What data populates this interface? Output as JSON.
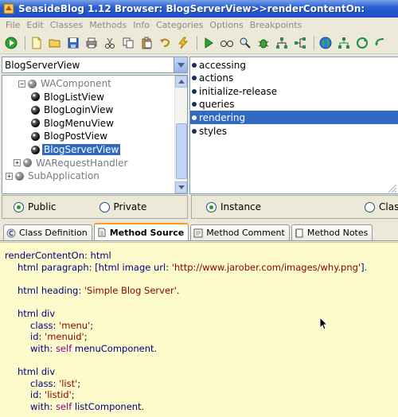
{
  "window": {
    "title": "SeasideBlog 1.12 Browser: BlogServerView>>renderContentOn:"
  },
  "menu": {
    "items": [
      "File",
      "Edit",
      "Classes",
      "Methods",
      "Info",
      "Categories",
      "Options",
      "Breakpoints"
    ]
  },
  "toolbar": {
    "icons": [
      "run-icon",
      "new-page-icon",
      "open-folder-icon",
      "save-icon",
      "print-icon",
      "cut-icon",
      "copy-icon",
      "paste-icon",
      "undo-icon",
      "lightning-icon",
      "play-icon",
      "glasses-icon",
      "magnifier-icon",
      "bug-icon",
      "hierarchy-icon",
      "hierarchy2-icon",
      "globe-icon",
      "tree-icon",
      "refresh-icon",
      "back-icon"
    ]
  },
  "class_pane": {
    "selected_class": "BlogServerView",
    "tree": [
      {
        "label": "WAComponent",
        "indent": 1,
        "expander": "−",
        "grey": true,
        "selected": false
      },
      {
        "label": "BlogListView",
        "indent": 2,
        "expander": "",
        "grey": false,
        "selected": false
      },
      {
        "label": "BlogLoginView",
        "indent": 2,
        "expander": "",
        "grey": false,
        "selected": false
      },
      {
        "label": "BlogMenuView",
        "indent": 2,
        "expander": "",
        "grey": false,
        "selected": false
      },
      {
        "label": "BlogPostView",
        "indent": 2,
        "expander": "",
        "grey": false,
        "selected": false
      },
      {
        "label": "BlogServerView",
        "indent": 2,
        "expander": "",
        "grey": false,
        "selected": true
      },
      {
        "label": "WARequestHandler",
        "indent": 0,
        "expander": "+",
        "grey": true,
        "selected": false
      },
      {
        "label": "SubApplication",
        "indent": -1,
        "expander": "+",
        "grey": true,
        "selected": false
      }
    ]
  },
  "protocol_pane": {
    "items": [
      "accessing",
      "actions",
      "initialize-release",
      "queries",
      "rendering",
      "styles"
    ],
    "selected": "rendering"
  },
  "visibility_radio": {
    "options": [
      {
        "label": "Public",
        "checked": true
      },
      {
        "label": "Private",
        "checked": false
      }
    ]
  },
  "side_radio": {
    "options": [
      {
        "label": "Instance",
        "checked": true
      },
      {
        "label": "Clas",
        "checked": false
      }
    ]
  },
  "tabs": [
    {
      "label": "Class Definition",
      "icon": "class-icon",
      "active": false
    },
    {
      "label": "Method Source",
      "icon": "document-icon",
      "active": true
    },
    {
      "label": "Method Comment",
      "icon": "comment-icon",
      "active": false
    },
    {
      "label": "Method Notes",
      "icon": "notes-icon",
      "active": false
    }
  ],
  "source": {
    "lines": [
      {
        "indent": 0,
        "parts": [
          {
            "t": "renderContentOn: html",
            "c": "kw"
          }
        ]
      },
      {
        "indent": 1,
        "parts": [
          {
            "t": "html paragraph: [html image url: ",
            "c": "kw"
          },
          {
            "t": "'http://www.jarober.com/images/why.png'",
            "c": "str"
          },
          {
            "t": "].",
            "c": "kw"
          }
        ]
      },
      {
        "indent": 0,
        "parts": []
      },
      {
        "indent": 1,
        "parts": [
          {
            "t": "html heading: ",
            "c": "kw"
          },
          {
            "t": "'Simple Blog Server'",
            "c": "str"
          },
          {
            "t": ".",
            "c": "kw"
          }
        ]
      },
      {
        "indent": 0,
        "parts": []
      },
      {
        "indent": 1,
        "parts": [
          {
            "t": "html div",
            "c": "kw"
          }
        ]
      },
      {
        "indent": 2,
        "parts": [
          {
            "t": "class: ",
            "c": "kw"
          },
          {
            "t": "'menu'",
            "c": "str"
          },
          {
            "t": ";",
            "c": "kw"
          }
        ]
      },
      {
        "indent": 2,
        "parts": [
          {
            "t": "id: ",
            "c": "kw"
          },
          {
            "t": "'menuid'",
            "c": "str"
          },
          {
            "t": ";",
            "c": "kw"
          }
        ]
      },
      {
        "indent": 2,
        "parts": [
          {
            "t": "with:  ",
            "c": "kw"
          },
          {
            "t": "self",
            "c": "self"
          },
          {
            "t": " menuComponent.",
            "c": "kw"
          }
        ]
      },
      {
        "indent": 0,
        "parts": []
      },
      {
        "indent": 1,
        "parts": [
          {
            "t": "html div",
            "c": "kw"
          }
        ]
      },
      {
        "indent": 2,
        "parts": [
          {
            "t": "class: ",
            "c": "kw"
          },
          {
            "t": "'list'",
            "c": "str"
          },
          {
            "t": ";",
            "c": "kw"
          }
        ]
      },
      {
        "indent": 2,
        "parts": [
          {
            "t": "id: ",
            "c": "kw"
          },
          {
            "t": "'listid'",
            "c": "str"
          },
          {
            "t": ";",
            "c": "kw"
          }
        ]
      },
      {
        "indent": 2,
        "parts": [
          {
            "t": "with:  ",
            "c": "kw"
          },
          {
            "t": "self",
            "c": "self"
          },
          {
            "t": " listComponent.",
            "c": "kw"
          }
        ]
      }
    ]
  },
  "colors": {
    "selection": "#316ac5",
    "editor_bg": "#fdfbcb",
    "title_blue": "#2a5fd6"
  }
}
